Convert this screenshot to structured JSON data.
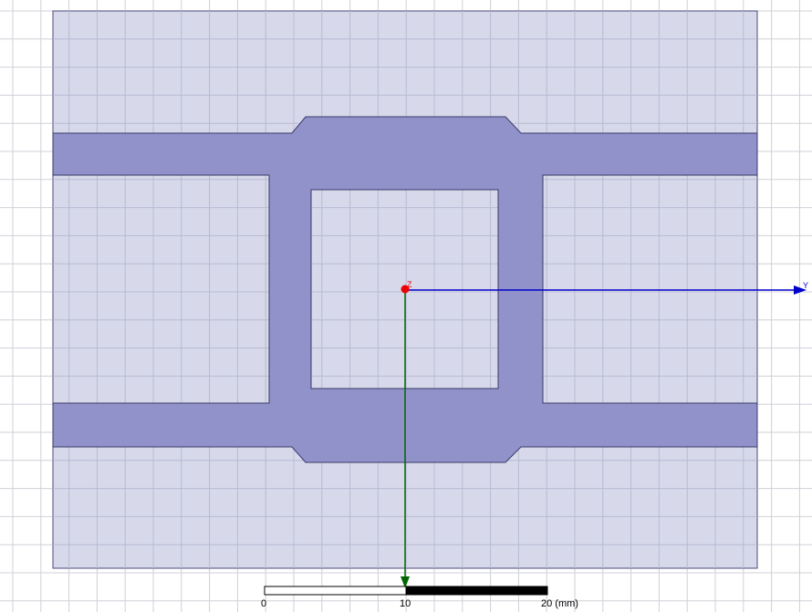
{
  "colors": {
    "background": "#ffffff",
    "grid_line": "#d0d0d8",
    "substrate_fill": "#d3d5e8",
    "substrate_edge": "#4a4a7a",
    "trace_fill": "#9292cb",
    "trace_edge": "#3a3a6a",
    "y_axis": "#0000cc",
    "x_axis": "#006600",
    "z_marker": "#ee0000"
  },
  "axes": {
    "y_label": "Y",
    "z_label": "Z"
  },
  "scale_bar": {
    "labels": [
      "0",
      "10",
      "20 (mm)"
    ]
  }
}
